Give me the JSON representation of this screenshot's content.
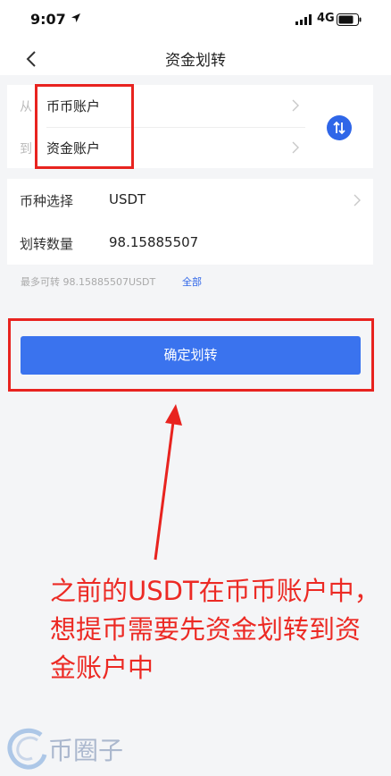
{
  "status_bar": {
    "time": "9:07",
    "network": "4G",
    "icons": [
      "location-arrow-icon",
      "signal-icon",
      "battery-icon"
    ]
  },
  "nav": {
    "title": "资金划转",
    "back_icon": "chevron-left-icon"
  },
  "transfer": {
    "from_prefix": "从",
    "from_account": "币币账户",
    "to_prefix": "到",
    "to_account": "资金账户",
    "swap_icon": "swap-arrows-icon"
  },
  "form": {
    "coin_label": "币种选择",
    "coin_value": "USDT",
    "amount_label": "划转数量",
    "amount_value": "98.15885507"
  },
  "max_info": {
    "text": "最多可转 98.15885507USDT",
    "all_link": "全部"
  },
  "confirm_button": "确定划转",
  "annotation": {
    "text": "之前的USDT在币币账户中，想提币需要先资金划转到资金账户中",
    "color": "#ec2a24"
  },
  "watermark": {
    "text": "币圈子"
  },
  "colors": {
    "accent": "#3a73ee",
    "annotation_red": "#e8231f",
    "background": "#f4f5f7"
  }
}
